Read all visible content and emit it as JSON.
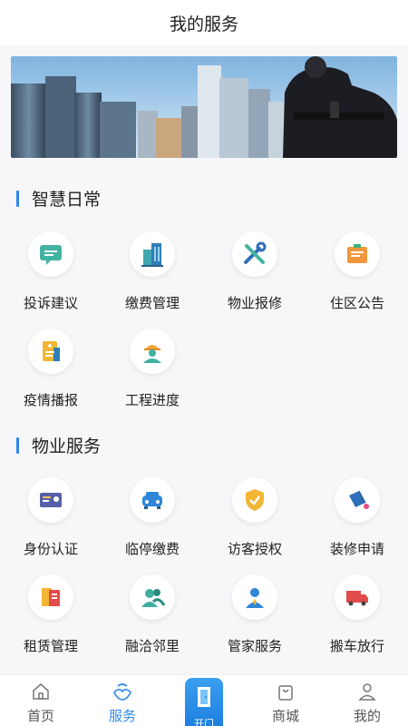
{
  "header": {
    "title": "我的服务"
  },
  "sections": [
    {
      "title": "智慧日常",
      "items": [
        {
          "label": "投诉建议",
          "icon": "message-icon"
        },
        {
          "label": "缴费管理",
          "icon": "building-icon"
        },
        {
          "label": "物业报修",
          "icon": "wrench-screwdriver-icon"
        },
        {
          "label": "住区公告",
          "icon": "notice-board-icon"
        },
        {
          "label": "疫情播报",
          "icon": "medical-report-icon"
        },
        {
          "label": "工程进度",
          "icon": "worker-icon"
        }
      ]
    },
    {
      "title": "物业服务",
      "items": [
        {
          "label": "身份认证",
          "icon": "id-card-icon"
        },
        {
          "label": "临停缴费",
          "icon": "car-icon"
        },
        {
          "label": "访客授权",
          "icon": "shield-check-icon"
        },
        {
          "label": "装修申请",
          "icon": "paint-bucket-icon"
        },
        {
          "label": "租赁管理",
          "icon": "document-icon"
        },
        {
          "label": "融洽邻里",
          "icon": "neighbors-icon"
        },
        {
          "label": "管家服务",
          "icon": "butler-icon"
        },
        {
          "label": "搬车放行",
          "icon": "truck-icon"
        }
      ]
    }
  ],
  "tabbar": {
    "items": [
      {
        "label": "首页",
        "icon": "home-icon",
        "active": false
      },
      {
        "label": "服务",
        "icon": "service-icon",
        "active": true
      },
      {
        "label": "开门",
        "icon": "door-icon",
        "active": false
      },
      {
        "label": "商城",
        "icon": "shopping-bag-icon",
        "active": false
      },
      {
        "label": "我的",
        "icon": "user-icon",
        "active": false
      }
    ]
  }
}
